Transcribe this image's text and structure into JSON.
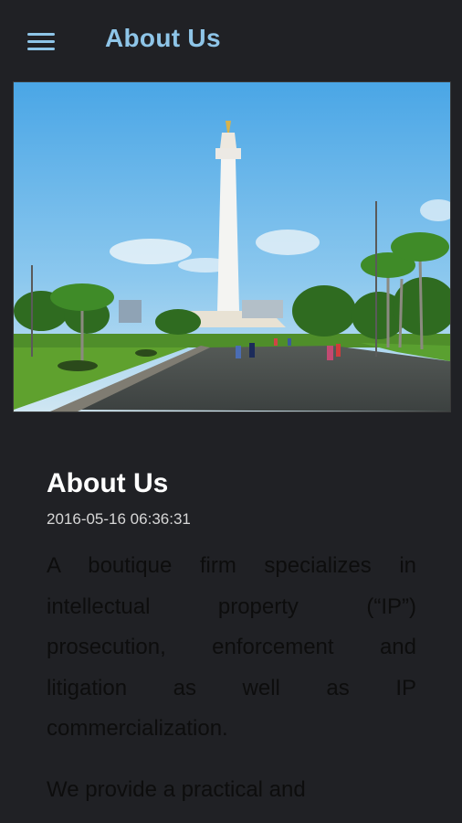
{
  "appbar": {
    "title": "About Us"
  },
  "article": {
    "title": "About Us",
    "date": "2016-05-16 06:36:31",
    "paragraphs": [
      "A boutique firm specializes in intellectual property (“IP”) prosecution, enforcement and litigation as well as IP commercialization.",
      "We provide a practical and"
    ]
  },
  "icons": {
    "menu": "hamburger-menu-icon"
  },
  "colors": {
    "background": "#202125",
    "accent": "#8ec5e8"
  }
}
